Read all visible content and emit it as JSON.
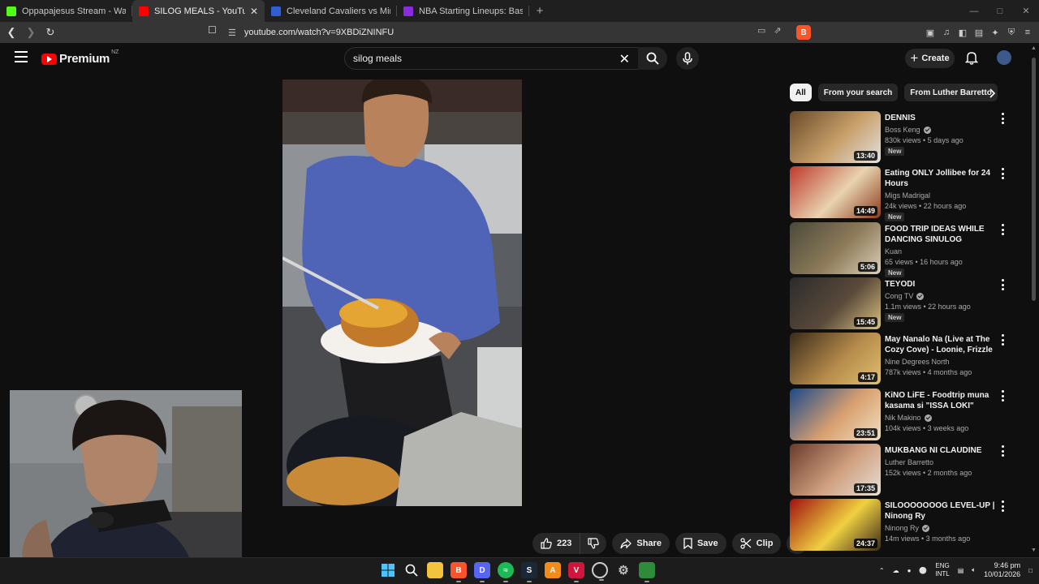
{
  "browser": {
    "tabs": [
      {
        "title": "Oppapajesus Stream - Watch Live on",
        "icon": "kick-icon",
        "color": "#53fc18"
      },
      {
        "title": "SILOG MEALS - YouTube",
        "icon": "youtube-icon",
        "color": "#ff0000",
        "active": true
      },
      {
        "title": "Cleveland Cavaliers vs Minnesota Tim",
        "icon": "nba-icon",
        "color": "#2f5ed6"
      },
      {
        "title": "NBA Starting Lineups: Basketball Da",
        "icon": "rotowire-icon",
        "color": "#8a2be2"
      }
    ],
    "url": "youtube.com/watch?v=9XBDiZNINFU"
  },
  "header": {
    "logo_text": "Premium",
    "region": "NZ",
    "search_value": "silog meals",
    "create_label": "Create"
  },
  "actions": {
    "like_count": "223",
    "share_label": "Share",
    "save_label": "Save",
    "clip_label": "Clip"
  },
  "chips": [
    "All",
    "From your search",
    "From Luther Barretto"
  ],
  "recommendations": [
    {
      "title": "DENNIS",
      "channel": "Boss Keng",
      "verified": true,
      "meta": "830k views • 5 days ago",
      "new": true,
      "duration": "13:40",
      "thumb_colors": [
        "#6b4a2a",
        "#c8a06a",
        "#e2e2e2"
      ]
    },
    {
      "title": "Eating ONLY Jollibee for 24 Hours",
      "channel": "Migs Madrigal",
      "verified": false,
      "meta": "24k views • 22 hours ago",
      "new": true,
      "duration": "14:49",
      "thumb_colors": [
        "#c0392b",
        "#e8d3b0",
        "#8a3a1a"
      ]
    },
    {
      "title": "FOOD TRIP IDEAS WHILE DANCING SINULOG FESTIVAL ...",
      "channel": "Kuan",
      "verified": false,
      "meta": "65 views • 16 hours ago",
      "new": true,
      "duration": "5:06",
      "thumb_colors": [
        "#4a4a3a",
        "#8e7b5a",
        "#d9d0b8"
      ]
    },
    {
      "title": "TEYODI",
      "channel": "Cong TV",
      "verified": true,
      "meta": "1.1m views • 22 hours ago",
      "new": true,
      "duration": "15:45",
      "thumb_colors": [
        "#2b2b2b",
        "#5a4a3a",
        "#d8c080"
      ]
    },
    {
      "title": "May Nanalo Na (Live at The Cozy Cove) - Loonie, Frizzle ...",
      "channel": "Nine Degrees North",
      "verified": false,
      "meta": "787k views • 4 months ago",
      "new": false,
      "duration": "4:17",
      "thumb_colors": [
        "#3a2a1a",
        "#b48a4a",
        "#e0c070"
      ]
    },
    {
      "title": "KiNO LiFE - Foodtrip muna kasama si \"ISSA LOKI\"",
      "channel": "Nik Makino",
      "verified": true,
      "meta": "104k views • 3 weeks ago",
      "new": false,
      "duration": "23:51",
      "thumb_colors": [
        "#1a4a8a",
        "#d8a070",
        "#f0e0c0"
      ]
    },
    {
      "title": "MUKBANG NI CLAUDINE",
      "channel": "Luther Barretto",
      "verified": false,
      "meta": "152k views • 2 months ago",
      "new": false,
      "duration": "17:35",
      "thumb_colors": [
        "#6a3a2a",
        "#d0a080",
        "#e6e0d8"
      ]
    },
    {
      "title": "SILOOOOOOOG LEVEL-UP | Ninong Ry",
      "channel": "Ninong Ry",
      "verified": true,
      "meta": "14m views • 3 months ago",
      "new": false,
      "duration": "24:37",
      "thumb_colors": [
        "#a01010",
        "#f0d040",
        "#3a2a1a"
      ]
    }
  ],
  "taskbar": {
    "lang_top": "ENG",
    "lang_bottom": "INTL",
    "time": "9:46 pm",
    "date": "10/01/2026"
  }
}
